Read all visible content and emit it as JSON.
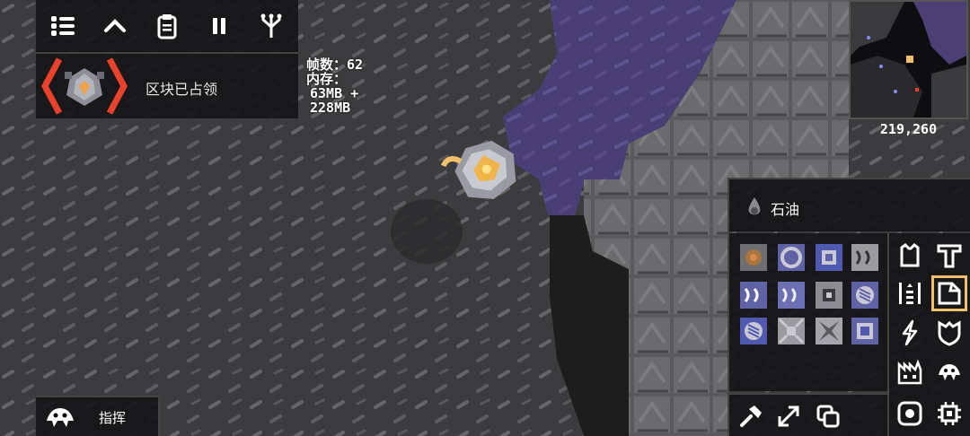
{
  "toolbar": {
    "icons": [
      "menu-icon",
      "chevron-up-icon",
      "clipboard-icon",
      "pause-icon",
      "tech-tree-icon"
    ]
  },
  "core": {
    "status_label": "区块已占领"
  },
  "stats": {
    "fps_label": "帧数：62",
    "memory_label": "内存：",
    "memory_line1": "63MB +",
    "memory_line2": "228MB"
  },
  "minimap": {
    "coords": "219,260"
  },
  "block_picker": {
    "selected_item": "石油",
    "item_icon": "oil-drop-icon",
    "blocks": [
      "scrap-block",
      "plastanium-ring-block",
      "plastanium-node-block",
      "titanium-conveyor-block",
      "armored-conveyor-block",
      "plastanium-conveyor-block",
      "junction-block",
      "bridge-block",
      "bridge-conduit-block",
      "router-block",
      "distributor-block",
      "sorter-block"
    ],
    "categories": [
      "turret-icon",
      "distribution-icon",
      "production-icon",
      "liquid-icon",
      "power-icon",
      "defense-icon",
      "crafting-icon",
      "units-icon",
      "effect-icon",
      "logic-icon"
    ],
    "selected_category": "liquid-icon",
    "tools": [
      "hammer-icon",
      "expand-icon",
      "copy-icon"
    ]
  },
  "command": {
    "label": "指挥"
  },
  "colors": {
    "accent": "#f2c06b",
    "core_red": "#e8432a",
    "spore": "#4b3f73"
  }
}
